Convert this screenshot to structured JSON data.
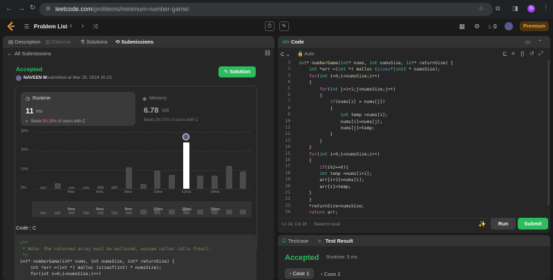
{
  "browser": {
    "url_host": "leetcode.com",
    "url_path": "/problems/minimum-number-game/",
    "profile_initial": "N"
  },
  "nav": {
    "problem_list": "Problem List",
    "streak": "0",
    "premium": "Premium"
  },
  "left_tabs": {
    "description": "Description",
    "editorial": "Editorial",
    "solutions": "Solutions",
    "submissions": "Submissions"
  },
  "submission": {
    "back": "All Submissions",
    "status": "Accepted",
    "user": "NAVEEN M",
    "submitted": "submitted at Mar 29, 2024 20:23",
    "solution_button": "Solution",
    "runtime_label": "Runtime",
    "runtime_value": "11",
    "runtime_unit": "ms",
    "runtime_beats_prefix": "Beats",
    "runtime_beats_pct": "59.28%",
    "runtime_beats_suffix": "of users with C",
    "memory_label": "Memory",
    "memory_value": "6.78",
    "memory_unit": "MB",
    "memory_beats": "Beats 39.37% of users with C"
  },
  "chart_data": {
    "type": "bar",
    "y_ticks": [
      "30%",
      "20%",
      "10%",
      "0%"
    ],
    "ylim": [
      0,
      30
    ],
    "x_tick_labels": [
      "4ms",
      "6ms",
      "8ms",
      "10ms",
      "12ms",
      "14ms"
    ],
    "values": [
      1,
      3,
      1,
      1,
      1.5,
      1.5,
      11.5,
      2.5,
      9.5,
      7.5,
      24.5,
      7,
      7,
      12,
      9
    ],
    "highlight_index": 10,
    "overview_labels": [
      "4ms",
      "6ms",
      "8ms",
      "10ms",
      "12ms",
      "14ms"
    ],
    "overview_values": [
      1,
      1,
      1,
      1,
      1,
      1,
      1,
      2,
      2,
      2,
      3,
      2,
      2,
      2,
      2
    ]
  },
  "bottom_code": {
    "header": "Code",
    "lang": "C",
    "lines": [
      "/**",
      " * Note: The returned array must be malloced, assume caller calls free().",
      " */",
      "int* numberGame(int* nums, int numsSize, int* returnSize) {",
      "    int *arr =(int *) malloc (sizeof(int) * numsSize);",
      "    for(int i=0;i<numsSize;i++)"
    ]
  },
  "editor": {
    "title": "Code",
    "lang": "C",
    "mode": "Auto",
    "status_pos": "Ln 24, Col 16",
    "status_saved": "Saved to local",
    "run": "Run",
    "submit": "Submit",
    "line_numbers": [
      "1",
      "2",
      "3",
      "4",
      "5",
      "6",
      "7",
      "8",
      "9",
      "10",
      "11",
      "12",
      "13",
      "14",
      "15",
      "16",
      "17",
      "18",
      "19",
      "20",
      "21",
      "22",
      "23",
      "24"
    ]
  },
  "testpanel": {
    "tab_testcase": "Testcase",
    "tab_result": "Test Result",
    "result": "Accepted",
    "runtime": "Runtime: 5 ms",
    "case1": "Case 1",
    "case2": "Case 2"
  },
  "colors": {
    "accent_green": "#2cbb5d",
    "bar_gray": "#4a4a4a",
    "bar_highlight": "#ffffff"
  }
}
